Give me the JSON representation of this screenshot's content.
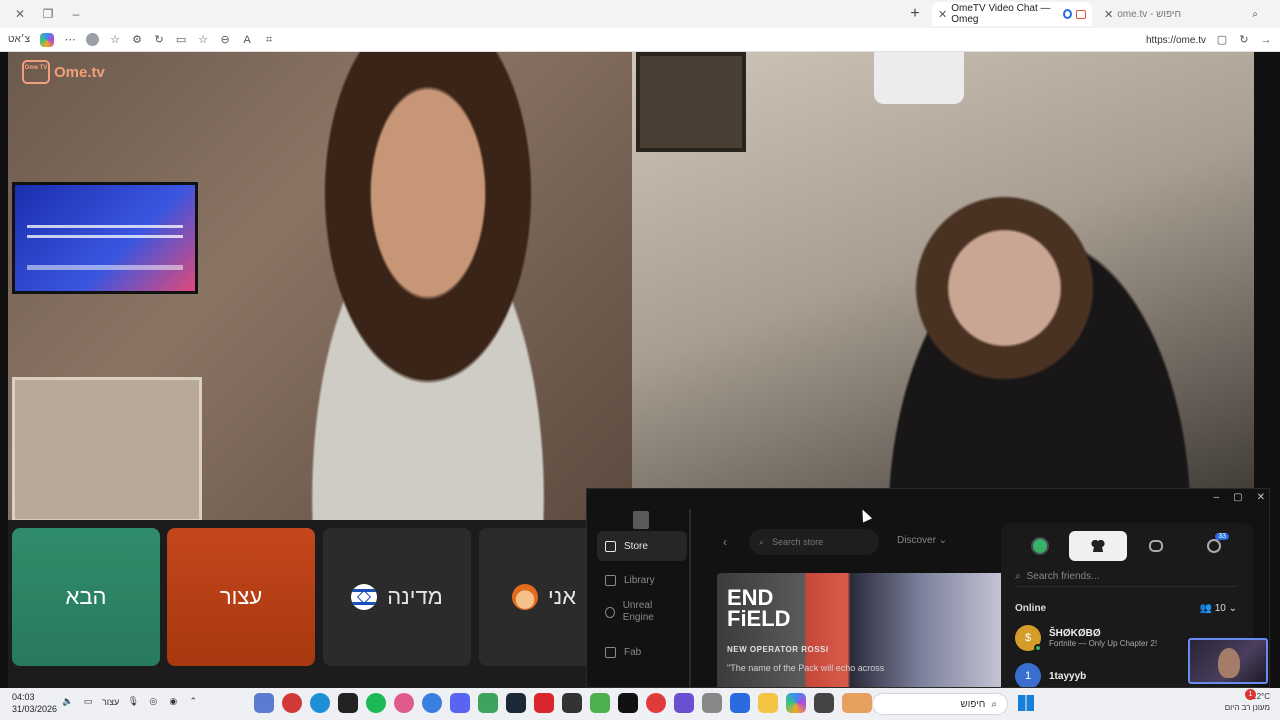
{
  "browser": {
    "tabs": [
      {
        "title": "OmeTV Video Chat — Omeg",
        "active": true
      },
      {
        "title": "ome.tv - חיפוש",
        "active": false
      }
    ],
    "profile_label": "צ׳אט",
    "url": "https://ome.tv"
  },
  "site": {
    "logo_text": "Ome.tv",
    "logo_badge": "Ome TV"
  },
  "controls": {
    "next_label": "הבא",
    "stop_label": "עצור",
    "country_label": "מדינה",
    "me_label": "אני",
    "colors": {
      "next": "#2f8c6a",
      "stop": "#c4461c",
      "neutral": "#2b2b2b"
    }
  },
  "epic": {
    "sidebar": [
      {
        "label": "Store",
        "active": true
      },
      {
        "label": "Library",
        "active": false
      },
      {
        "label": "Unreal Engine",
        "active": false
      },
      {
        "label": "Fab",
        "active": false
      }
    ],
    "search_placeholder": "Search store",
    "discover_label": "Discover",
    "banner": {
      "title": "END FiELD",
      "subtitle": "NEW OPERATOR ROSSI",
      "quote": "\"The name of the Pack will echo across"
    },
    "friends": {
      "search_placeholder": "Search friends...",
      "badge": "33",
      "online_label": "Online",
      "online_count": "10",
      "list": [
        {
          "name": "ŠHØKØBØ",
          "game": "Fortnite — Only Up Chapter 2!",
          "initial": "$"
        },
        {
          "name": "1tayyyb",
          "game": "",
          "initial": "1"
        }
      ]
    }
  },
  "taskbar": {
    "time": "04:03",
    "date": "31/03/2026",
    "stop_label": "עצור",
    "search_label": "חיפוש",
    "temp": "12°C",
    "weather_desc": "מעונן רב היום",
    "notification_count": "1"
  }
}
